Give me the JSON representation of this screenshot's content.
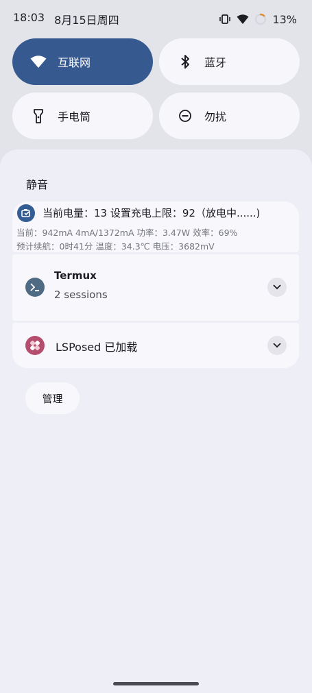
{
  "status_bar": {
    "time": "18:03",
    "date": "8月15日周四",
    "battery_percent": "13%",
    "battery_level": 0.13,
    "icons": [
      "vibrate-icon",
      "wifi-icon",
      "battery-ring-icon"
    ]
  },
  "quick_settings": {
    "tiles": [
      {
        "label": "互联网",
        "icon": "wifi-icon",
        "active": true
      },
      {
        "label": "蓝牙",
        "icon": "bluetooth-icon",
        "active": false
      },
      {
        "label": "手电筒",
        "icon": "flashlight-icon",
        "active": false
      },
      {
        "label": "勿扰",
        "icon": "do-not-disturb-icon",
        "active": false
      }
    ]
  },
  "shade": {
    "section_title": "静音",
    "battery_notification": {
      "title": "当前电量：13   设置充电上限：92（放电中......)",
      "line1": "当前：942mA    4mA/1372mA   功率：3.47W   效率：69%",
      "line2": "预计续航：0时41分    温度：34.3℃   电压：3682mV"
    },
    "termux_notification": {
      "title": "Termux",
      "subtitle": "2 sessions"
    },
    "lsposed_notification": {
      "title": "LSPosed 已加载"
    },
    "manage_label": "管理"
  },
  "colors": {
    "active_tile": "#36598f",
    "battery_icon_bg": "#345e93",
    "termux_icon_bg": "#4f6a83",
    "lsposed_icon_bg": "#b54e6e"
  }
}
